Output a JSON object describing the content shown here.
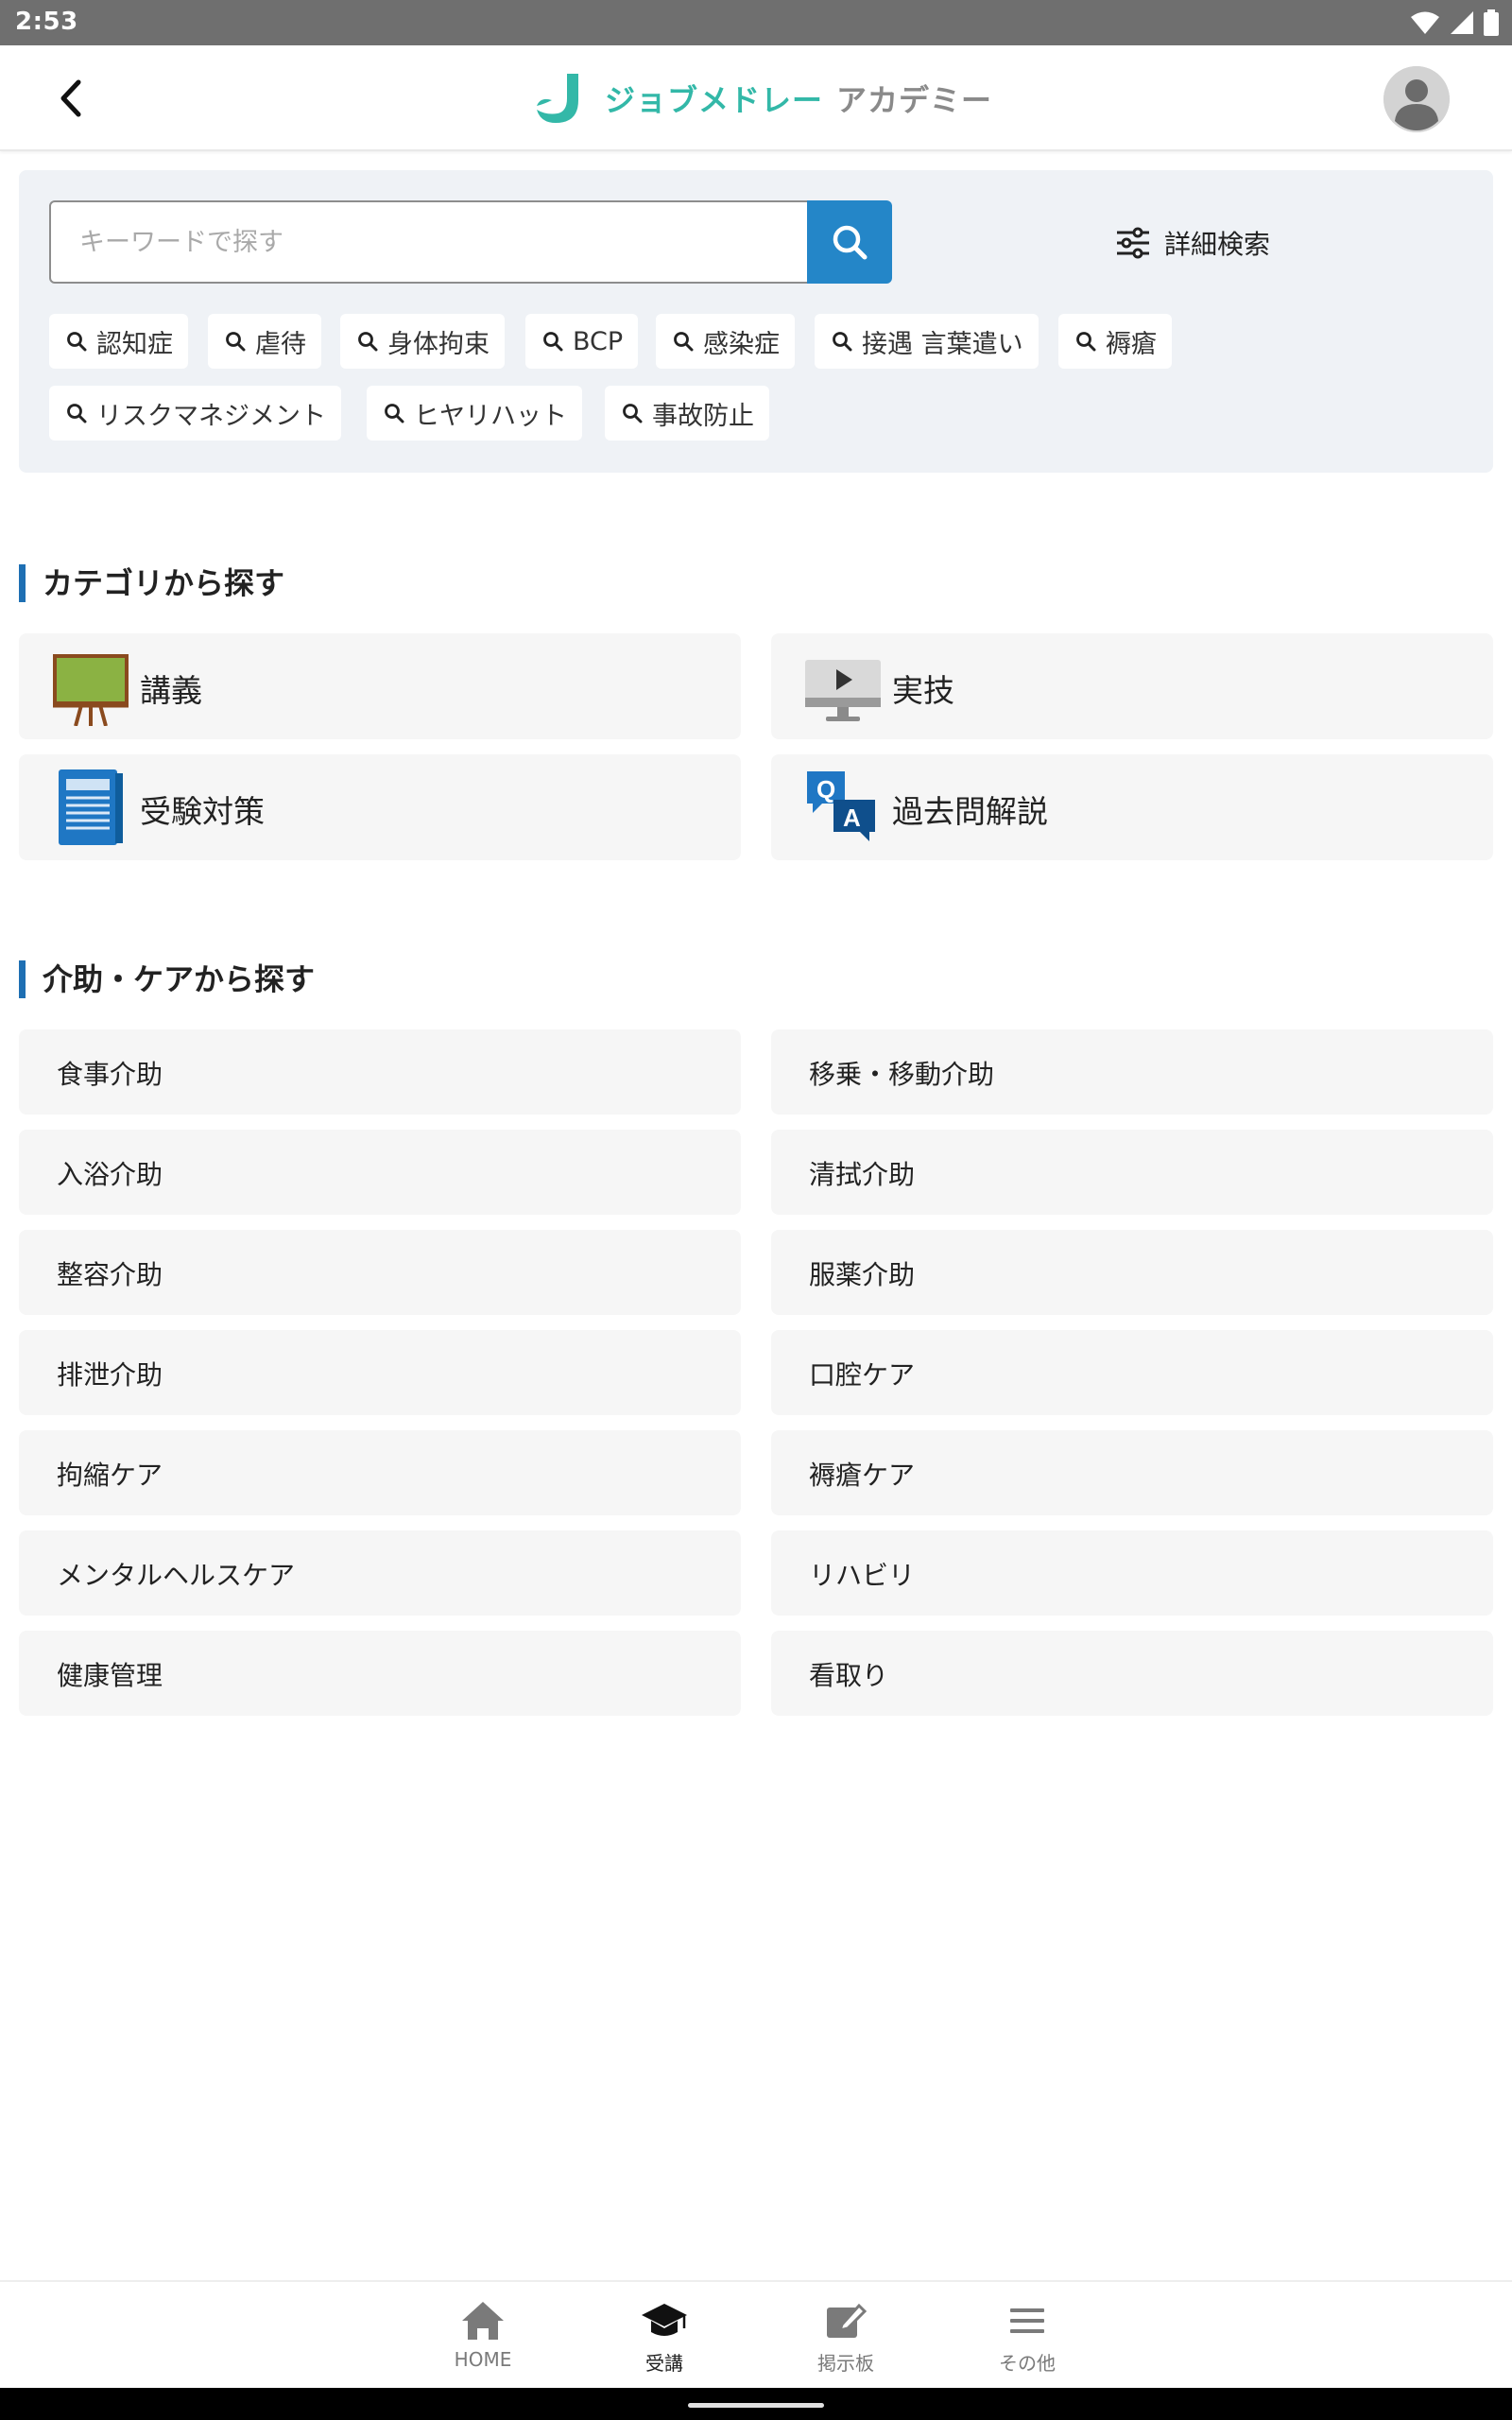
{
  "status_bar": {
    "time": "2:53"
  },
  "header": {
    "logo_text": "ジョブメドレー",
    "logo_sub": "アカデミー",
    "accent_color": "#33b8a8"
  },
  "search": {
    "placeholder": "キーワードで探す",
    "value": "",
    "detail_label": "詳細検索",
    "button_color": "#2486c8",
    "tags": [
      "認知症",
      "虐待",
      "身体拘束",
      "BCP",
      "感染症",
      "接遇 言葉遣い",
      "褥瘡",
      "リスクマネジメント",
      "ヒヤリハット",
      "事故防止"
    ]
  },
  "category_section": {
    "title": "カテゴリから探す",
    "items": [
      {
        "label": "講義",
        "icon": "blackboard-icon"
      },
      {
        "label": "実技",
        "icon": "monitor-play-icon"
      },
      {
        "label": "受験対策",
        "icon": "notebook-icon"
      },
      {
        "label": "過去問解説",
        "icon": "qa-icon"
      }
    ]
  },
  "care_section": {
    "title": "介助・ケアから探す",
    "items": [
      "食事介助",
      "移乗・移動介助",
      "入浴介助",
      "清拭介助",
      "整容介助",
      "服薬介助",
      "排泄介助",
      "口腔ケア",
      "拘縮ケア",
      "褥瘡ケア",
      "メンタルヘルスケア",
      "リハビリ",
      "健康管理",
      "看取り"
    ]
  },
  "bottom_nav": {
    "items": [
      {
        "label": "HOME",
        "icon": "home-icon"
      },
      {
        "label": "受講",
        "icon": "graduation-cap-icon"
      },
      {
        "label": "掲示板",
        "icon": "edit-board-icon"
      },
      {
        "label": "その他",
        "icon": "menu-icon"
      }
    ],
    "active": "受講"
  }
}
